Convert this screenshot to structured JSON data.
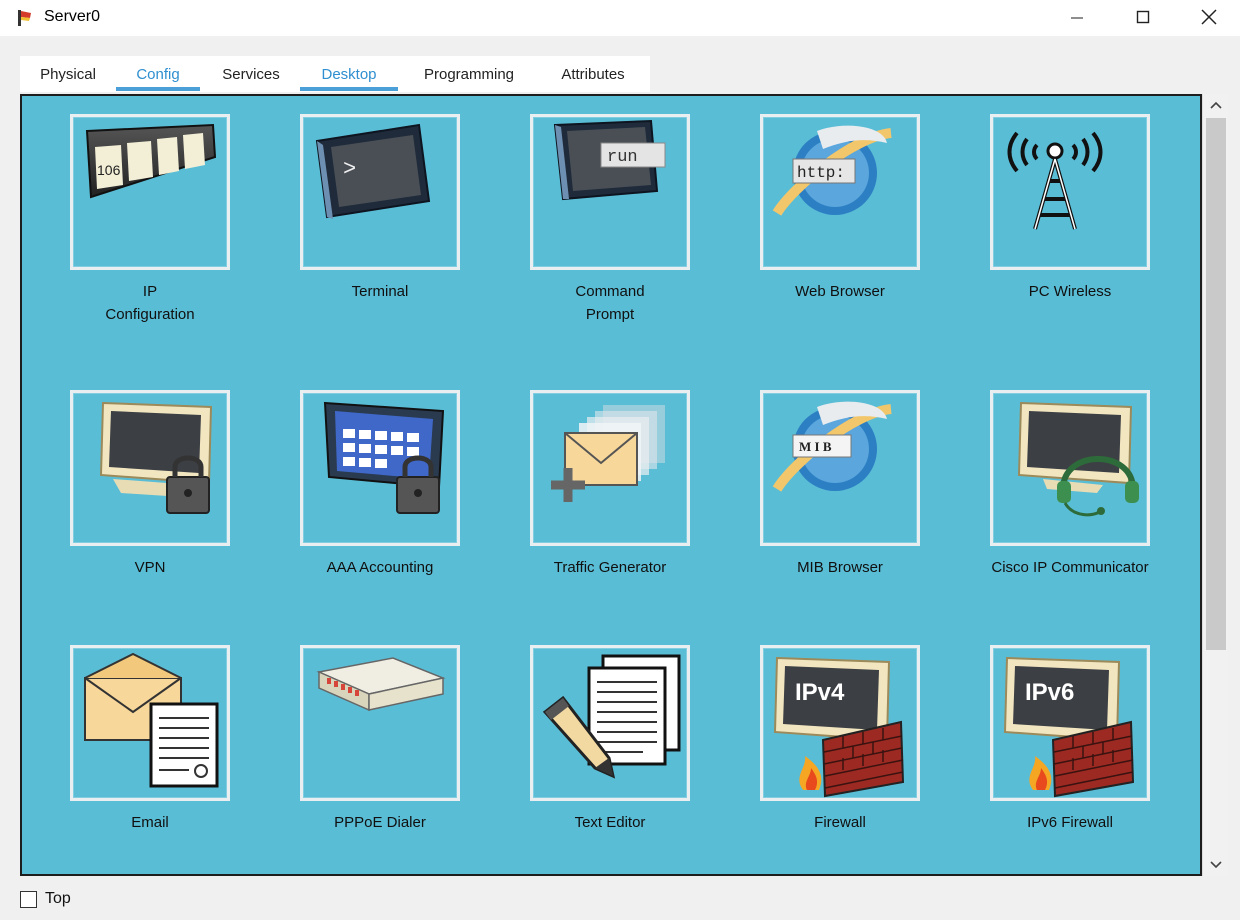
{
  "window": {
    "title": "Server0"
  },
  "tabs": [
    {
      "label": "Physical",
      "active": false
    },
    {
      "label": "Config",
      "active": true
    },
    {
      "label": "Services",
      "active": false
    },
    {
      "label": "Desktop",
      "active": true
    },
    {
      "label": "Programming",
      "active": false
    },
    {
      "label": "Attributes",
      "active": false
    }
  ],
  "desktop_apps": [
    {
      "label": "IP\nConfiguration",
      "icon": "ip-configuration-icon"
    },
    {
      "label": "Terminal",
      "icon": "terminal-icon"
    },
    {
      "label": "Command\nPrompt",
      "icon": "command-prompt-icon"
    },
    {
      "label": "Web Browser",
      "icon": "web-browser-icon"
    },
    {
      "label": "PC Wireless",
      "icon": "pc-wireless-icon"
    },
    {
      "label": "VPN",
      "icon": "vpn-icon"
    },
    {
      "label": "AAA Accounting",
      "icon": "aaa-accounting-icon"
    },
    {
      "label": "Traffic Generator",
      "icon": "traffic-generator-icon"
    },
    {
      "label": "MIB Browser",
      "icon": "mib-browser-icon"
    },
    {
      "label": "Cisco IP Communicator",
      "icon": "cisco-ip-communicator-icon"
    },
    {
      "label": "Email",
      "icon": "email-icon"
    },
    {
      "label": "PPPoE Dialer",
      "icon": "pppoe-dialer-icon"
    },
    {
      "label": "Text Editor",
      "icon": "text-editor-icon"
    },
    {
      "label": "Firewall",
      "icon": "firewall-icon"
    },
    {
      "label": "IPv6 Firewall",
      "icon": "ipv6-firewall-icon"
    }
  ],
  "icon_text": {
    "ip_config_number": "106",
    "terminal_prompt": ">",
    "command_prompt": "run",
    "web_browser": "http:",
    "mib_browser": "M I B",
    "firewall": "IPv4",
    "ipv6_firewall": "IPv6"
  },
  "footer": {
    "checkbox_label": "Top",
    "checked": false
  },
  "colors": {
    "panel_bg": "#5abdd6",
    "active_tab": "#2f8fd0"
  }
}
